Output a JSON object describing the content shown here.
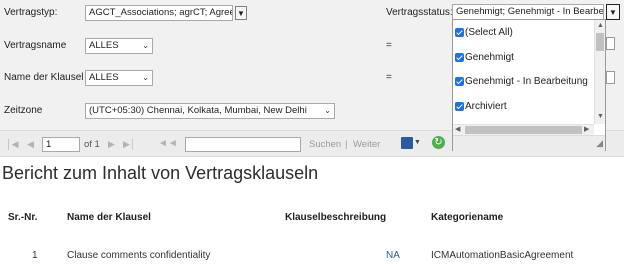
{
  "params": {
    "vertragstyp": {
      "label": "Vertragstyp:",
      "value": "AGCT_Associations; agrCT; Agreem"
    },
    "vertragsname": {
      "label": "Vertragsname",
      "value": "ALLES",
      "operator": "="
    },
    "klausel": {
      "label": "Name der Klausel",
      "value": "ALLES",
      "operator": "="
    },
    "zeitzone": {
      "label": "Zeitzone",
      "value": "(UTC+05:30) Chennai, Kolkata, Mumbai, New Delhi"
    },
    "vertragsstatus": {
      "label": "Vertragsstatus:",
      "value": "Genehmigt; Genehmigt - In Bearbeitung",
      "options": [
        {
          "label": "(Select All)",
          "checked": true
        },
        {
          "label": "Genehmigt",
          "checked": true
        },
        {
          "label": "Genehmigt - In Bearbeitung",
          "checked": true
        },
        {
          "label": "Archiviert",
          "checked": true
        }
      ]
    }
  },
  "toolbar": {
    "page_value": "1",
    "page_of": "of 1",
    "search_label": "Suchen",
    "separator": "|",
    "next_label": "Weiter"
  },
  "report": {
    "title": "Bericht zum Inhalt von Vertragsklauseln",
    "columns": [
      "Sr.-Nr.",
      "Name der Klausel",
      "Klauselbeschreibung",
      "Kategoriename"
    ],
    "rows": [
      [
        "1",
        "Clause comments confidentiality",
        "NA",
        "ICMAutomationBasicAgreement"
      ]
    ],
    "link_color": "#1f5fa8"
  },
  "colors": {
    "checkbox": "#1a73e8",
    "param_bg": "#f1f1f1",
    "toolbar_bg": "#ececec"
  }
}
